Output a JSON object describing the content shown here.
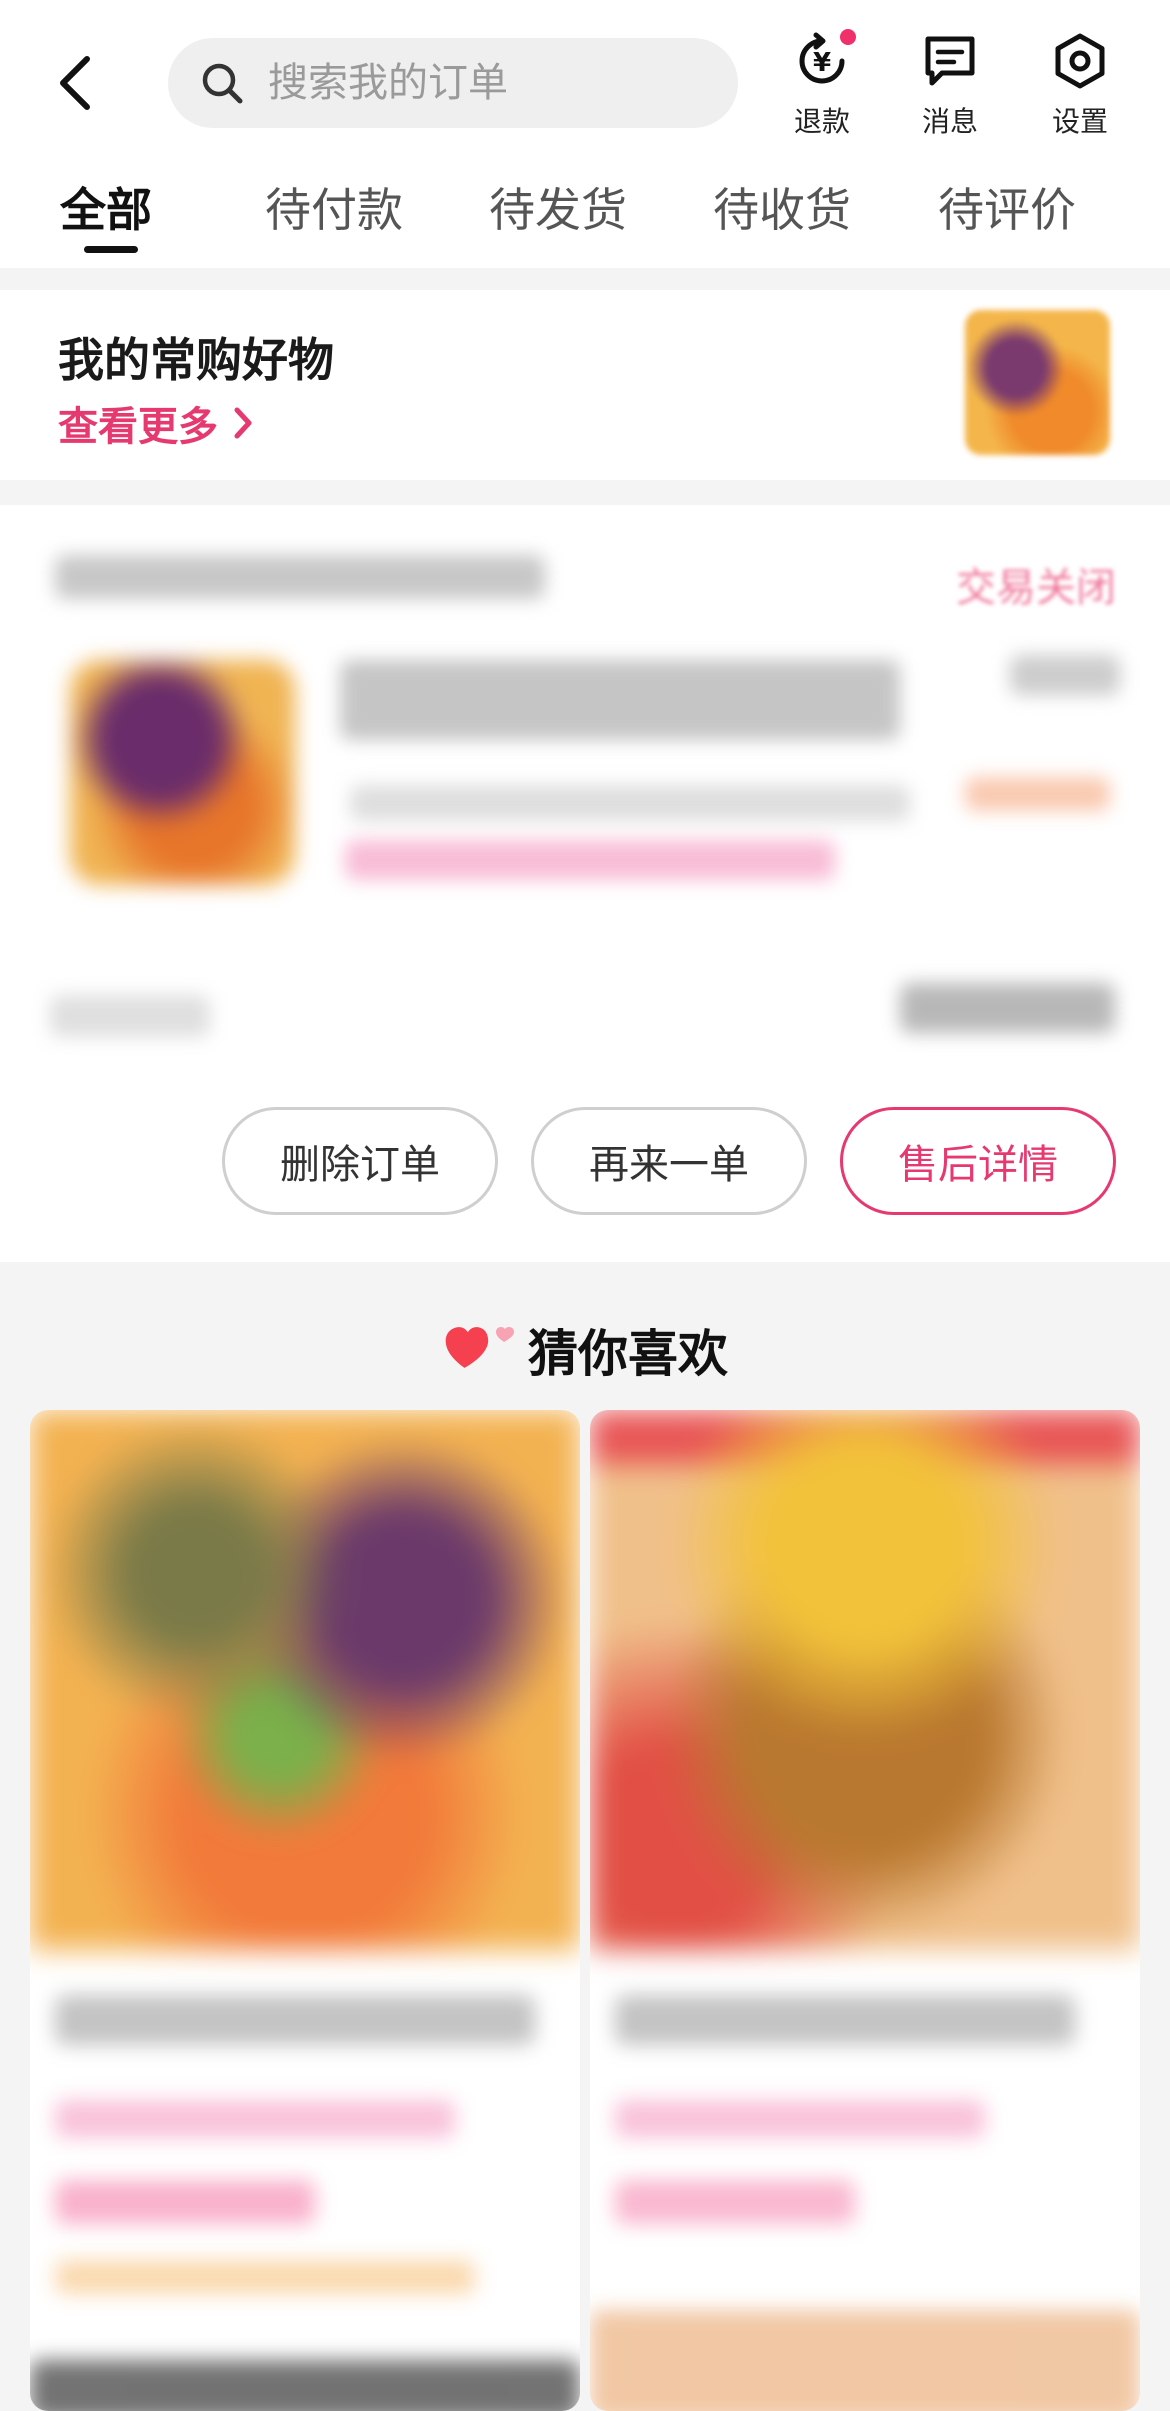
{
  "header": {
    "search": {
      "placeholder": "搜索我的订单"
    },
    "actions": [
      {
        "label": "退款",
        "icon": "refund-icon",
        "has_badge": true
      },
      {
        "label": "消息",
        "icon": "message-icon"
      },
      {
        "label": "设置",
        "icon": "settings-icon"
      }
    ],
    "tabs": [
      {
        "label": "全部",
        "active": true
      },
      {
        "label": "待付款"
      },
      {
        "label": "待发货"
      },
      {
        "label": "待收货"
      },
      {
        "label": "待评价"
      }
    ]
  },
  "favorites": {
    "title": "我的常购好物",
    "more_label": "查看更多"
  },
  "order": {
    "status": "交易关闭",
    "buttons": {
      "delete": "删除订单",
      "reorder": "再来一单",
      "after_sale": "售后详情"
    }
  },
  "recommend": {
    "title": "猜你喜欢"
  },
  "colors": {
    "accent": "#e6396f",
    "badge": "#f0306a",
    "background": "#f4f4f5"
  }
}
